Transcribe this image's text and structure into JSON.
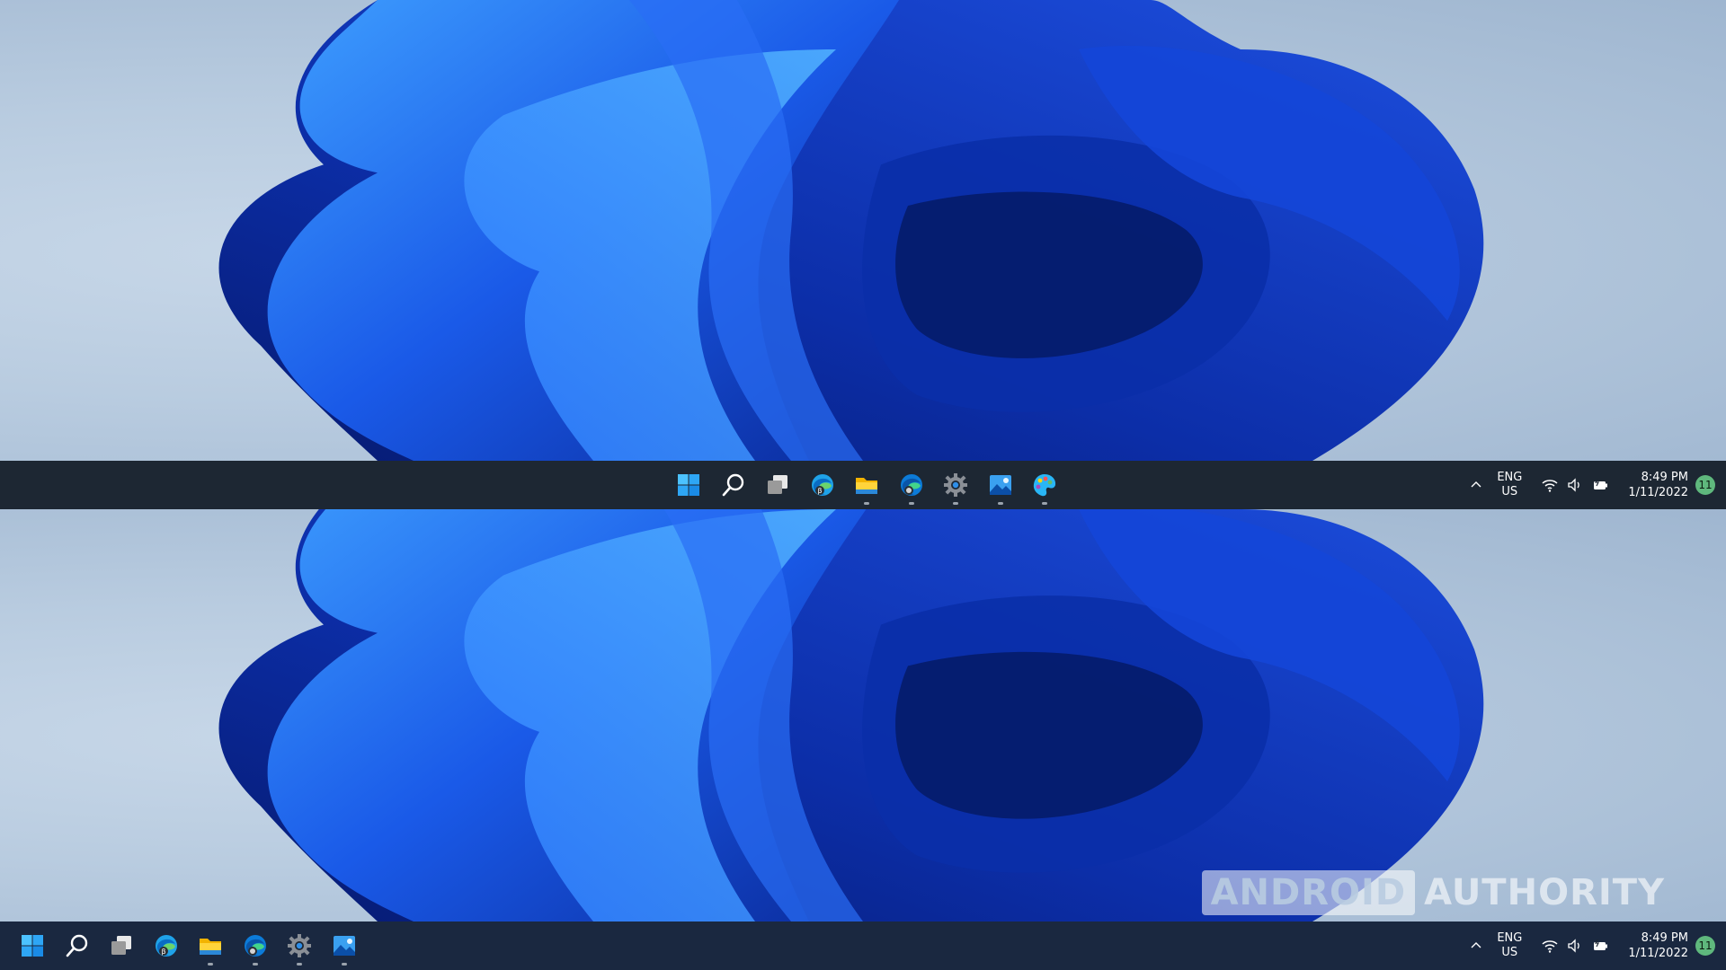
{
  "desktop": {
    "name": "Windows 11 desktop",
    "wallpaper_colors": {
      "background": "#b8cbe0",
      "bloom_dark": "#0a2a9a",
      "bloom_mid": "#1a55e0",
      "bloom_light": "#3c9bff"
    }
  },
  "taskbar_top": {
    "alignment": "center",
    "apps": [
      {
        "icon": "start-icon",
        "running": false
      },
      {
        "icon": "search-icon",
        "running": false
      },
      {
        "icon": "task-view-icon",
        "running": false
      },
      {
        "icon": "edge-beta-icon",
        "running": false
      },
      {
        "icon": "file-explorer-icon",
        "running": true
      },
      {
        "icon": "edge-icon",
        "running": true
      },
      {
        "icon": "settings-icon",
        "running": true
      },
      {
        "icon": "photos-icon",
        "running": true
      },
      {
        "icon": "paint-icon",
        "running": true
      }
    ],
    "tray": {
      "lang_line1": "ENG",
      "lang_line2": "US",
      "time": "8:49 PM",
      "date": "1/11/2022",
      "notification_count": "11"
    }
  },
  "taskbar_bottom": {
    "alignment": "left",
    "apps": [
      {
        "icon": "start-icon",
        "running": false
      },
      {
        "icon": "search-icon",
        "running": false
      },
      {
        "icon": "task-view-icon",
        "running": false
      },
      {
        "icon": "edge-beta-icon",
        "running": false
      },
      {
        "icon": "file-explorer-icon",
        "running": true
      },
      {
        "icon": "edge-icon",
        "running": true
      },
      {
        "icon": "settings-icon",
        "running": true
      },
      {
        "icon": "photos-icon",
        "running": true
      }
    ],
    "tray": {
      "lang_line1": "ENG",
      "lang_line2": "US",
      "time": "8:49 PM",
      "date": "1/11/2022",
      "notification_count": "11"
    }
  },
  "watermark": {
    "part1": "ANDROID",
    "part2": "AUTHORITY"
  }
}
